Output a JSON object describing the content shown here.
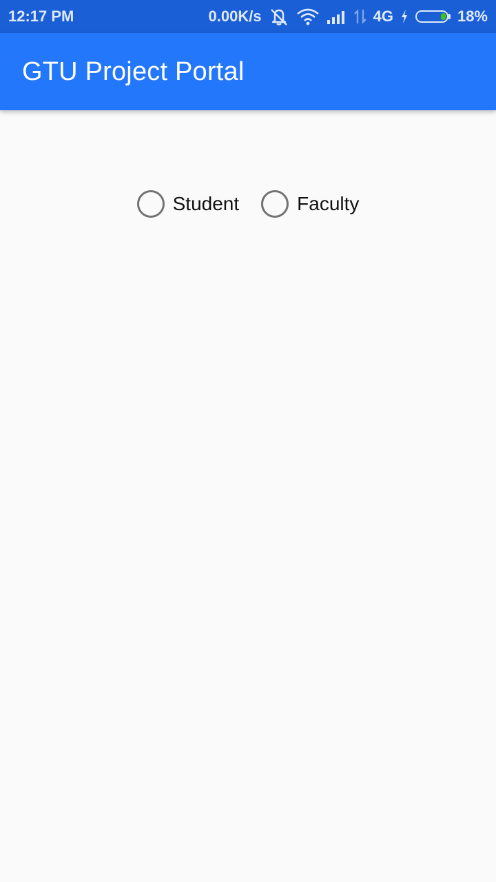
{
  "status_bar": {
    "time": "12:17 PM",
    "net_speed": "0.00K/s",
    "network_type": "4G",
    "battery_percent": "18%",
    "battery_level": 0.18,
    "icons": [
      "alarm-off-icon",
      "wifi-icon",
      "signal-icon",
      "data-arrows-icon",
      "charging-icon",
      "battery-icon"
    ]
  },
  "app_bar": {
    "title": "GTU Project Portal",
    "color": "#2277fb"
  },
  "user_type": {
    "options": [
      {
        "label": "Student",
        "selected": false
      },
      {
        "label": "Faculty",
        "selected": false
      }
    ]
  }
}
